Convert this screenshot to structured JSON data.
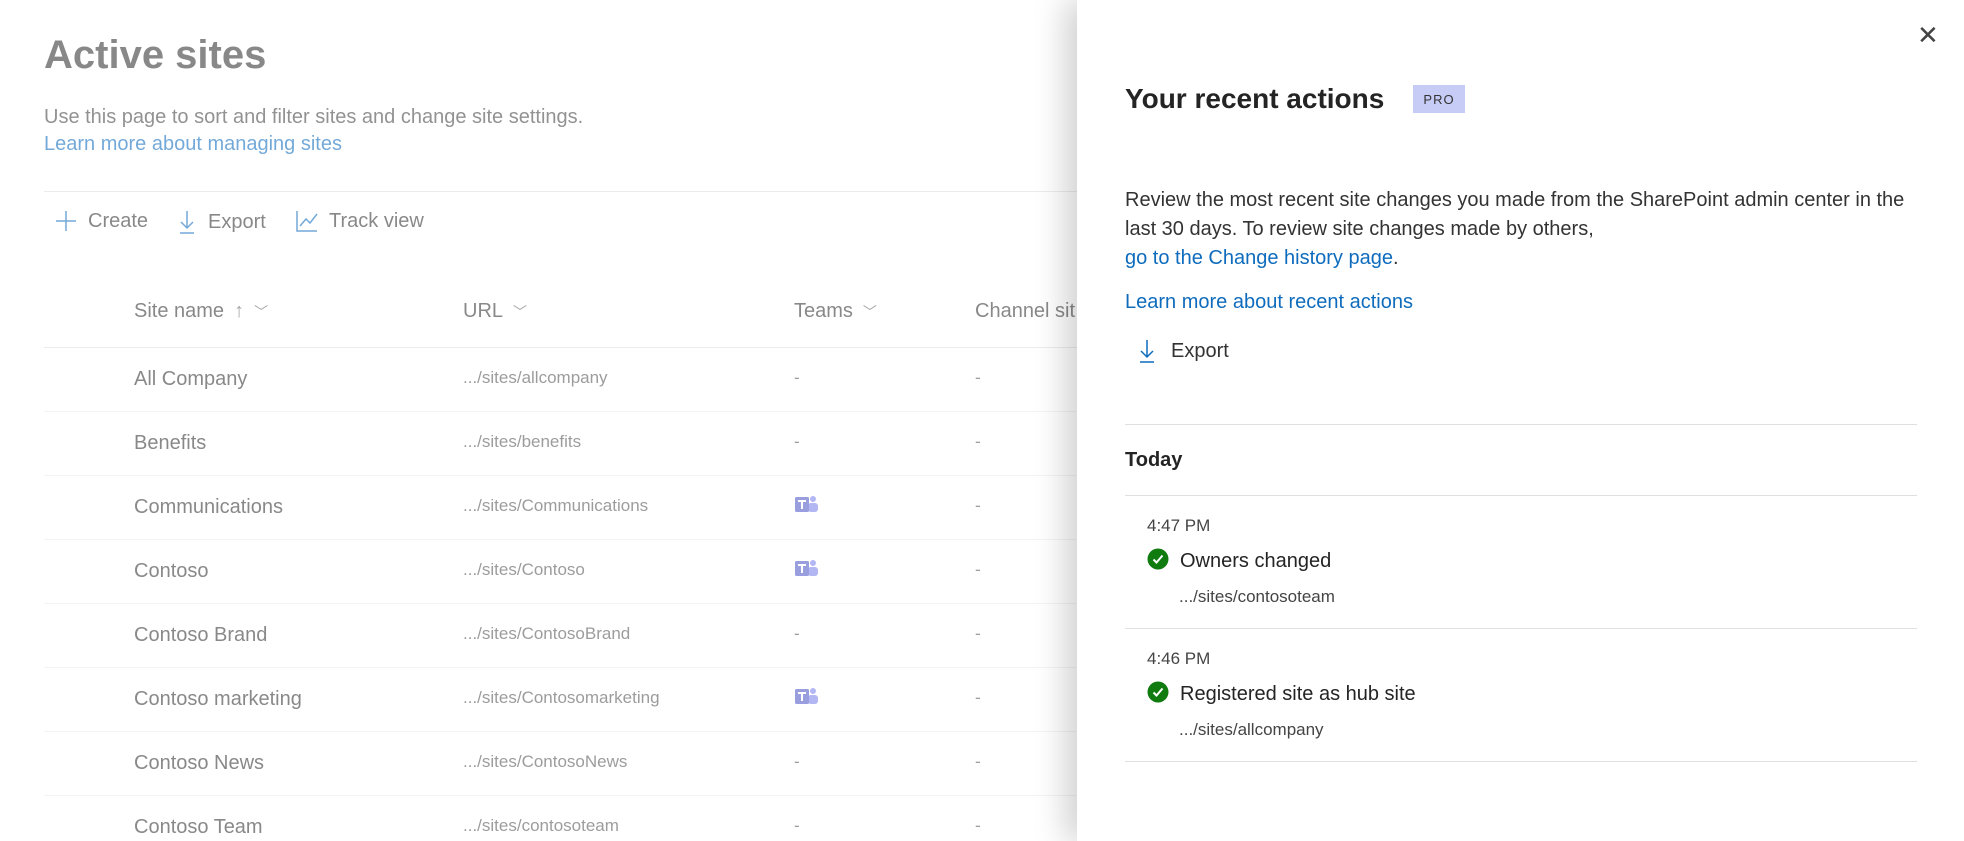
{
  "page": {
    "title": "Active sites",
    "subtitle": "Use this page to sort and filter sites and change site settings.",
    "learn_more": "Learn more about managing sites"
  },
  "toolbar": {
    "create": "Create",
    "export": "Export",
    "track_view": "Track view"
  },
  "columns": {
    "site_name": "Site name",
    "url": "URL",
    "teams": "Teams",
    "channel_sites": "Channel sit"
  },
  "rows": [
    {
      "name": "All Company",
      "url": ".../sites/allcompany",
      "teams": "-",
      "channel": "-",
      "teams_icon": false
    },
    {
      "name": "Benefits",
      "url": ".../sites/benefits",
      "teams": "-",
      "channel": "-",
      "teams_icon": false
    },
    {
      "name": "Communications",
      "url": ".../sites/Communications",
      "teams": "",
      "channel": "-",
      "teams_icon": true
    },
    {
      "name": "Contoso",
      "url": ".../sites/Contoso",
      "teams": "",
      "channel": "-",
      "teams_icon": true
    },
    {
      "name": "Contoso Brand",
      "url": ".../sites/ContosoBrand",
      "teams": "-",
      "channel": "-",
      "teams_icon": false
    },
    {
      "name": "Contoso marketing",
      "url": ".../sites/Contosomarketing",
      "teams": "",
      "channel": "-",
      "teams_icon": true
    },
    {
      "name": "Contoso News",
      "url": ".../sites/ContosoNews",
      "teams": "-",
      "channel": "-",
      "teams_icon": false
    },
    {
      "name": "Contoso Team",
      "url": ".../sites/contosoteam",
      "teams": "-",
      "channel": "-",
      "teams_icon": false
    }
  ],
  "panel": {
    "title": "Your recent actions",
    "badge": "PRO",
    "description": "Review the most recent site changes you made from the SharePoint admin center in the last 30 days. To review site changes made by others,",
    "change_history_link": "go to the Change history page",
    "period": ".",
    "learn_more": "Learn more about recent actions",
    "export": "Export",
    "group": "Today",
    "actions": [
      {
        "time": "4:47 PM",
        "action": "Owners changed",
        "site": ".../sites/contosoteam",
        "status": "success"
      },
      {
        "time": "4:46 PM",
        "action": "Registered site as hub site",
        "site": ".../sites/allcompany",
        "status": "success"
      }
    ]
  },
  "colors": {
    "accent": "#0f6cbd",
    "success": "#107c10",
    "badge": "#c7ccf7"
  }
}
